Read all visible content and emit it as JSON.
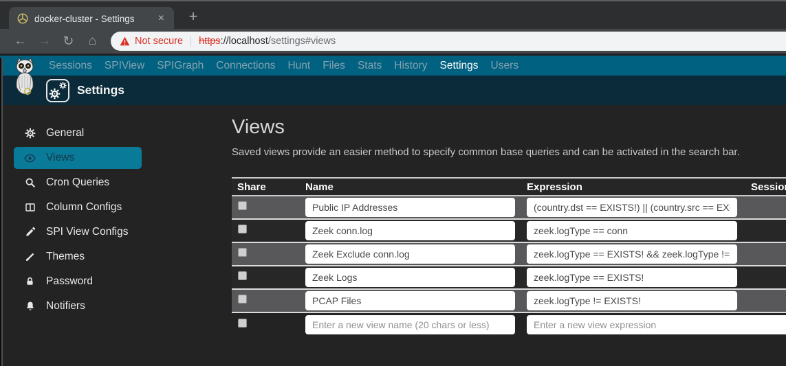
{
  "browser": {
    "tab": {
      "title": "docker-cluster - Settings",
      "close_glyph": "×",
      "new_tab_glyph": "+"
    },
    "toolbar": {
      "back_glyph": "←",
      "forward_glyph": "→",
      "reload_glyph": "↻",
      "home_glyph": "⌂",
      "security_warning": "Not secure",
      "url": {
        "scheme": "https",
        "host": "://localhost",
        "path": "/settings#views"
      }
    }
  },
  "navbar": {
    "items": [
      {
        "label": "Sessions",
        "active": false
      },
      {
        "label": "SPIView",
        "active": false
      },
      {
        "label": "SPIGraph",
        "active": false
      },
      {
        "label": "Connections",
        "active": false
      },
      {
        "label": "Hunt",
        "active": false
      },
      {
        "label": "Files",
        "active": false
      },
      {
        "label": "Stats",
        "active": false
      },
      {
        "label": "History",
        "active": false
      },
      {
        "label": "Settings",
        "active": true
      },
      {
        "label": "Users",
        "active": false
      }
    ]
  },
  "subheader": {
    "title": "Settings"
  },
  "sidebar": {
    "items": [
      {
        "label": "General",
        "icon": "gear-icon",
        "active": false
      },
      {
        "label": "Views",
        "icon": "eye-icon",
        "active": true
      },
      {
        "label": "Cron Queries",
        "icon": "search-icon",
        "active": false
      },
      {
        "label": "Column Configs",
        "icon": "columns-icon",
        "active": false
      },
      {
        "label": "SPI View Configs",
        "icon": "eyedropper-icon",
        "active": false
      },
      {
        "label": "Themes",
        "icon": "brush-icon",
        "active": false
      },
      {
        "label": "Password",
        "icon": "lock-icon",
        "active": false
      },
      {
        "label": "Notifiers",
        "icon": "bell-icon",
        "active": false
      }
    ]
  },
  "main": {
    "title": "Views",
    "description": "Saved views provide an easier method to specify common base queries and can be activated in the search bar.",
    "table": {
      "headers": [
        "Share",
        "Name",
        "Expression",
        "Sessions"
      ],
      "rows": [
        {
          "shared": false,
          "name": "Public IP Addresses",
          "expression": "(country.dst == EXISTS!) || (country.src == EXIS"
        },
        {
          "shared": false,
          "name": "Zeek conn.log",
          "expression": "zeek.logType == conn"
        },
        {
          "shared": false,
          "name": "Zeek Exclude conn.log",
          "expression": "zeek.logType == EXISTS! && zeek.logType !="
        },
        {
          "shared": false,
          "name": "Zeek Logs",
          "expression": "zeek.logType == EXISTS!"
        },
        {
          "shared": false,
          "name": "PCAP Files",
          "expression": "zeek.logType != EXISTS!"
        }
      ],
      "new_row": {
        "name_placeholder": "Enter a new view name (20 chars or less)",
        "expression_placeholder": "Enter a new view expression"
      }
    }
  },
  "colors": {
    "navbar_teal": "#016180",
    "subheader_navy": "#0b2a3a",
    "active_sidebar_item": "#0a7a99",
    "not_secure_red": "#d93025",
    "page_background": "#232323",
    "row_stripe": "#58585a"
  }
}
